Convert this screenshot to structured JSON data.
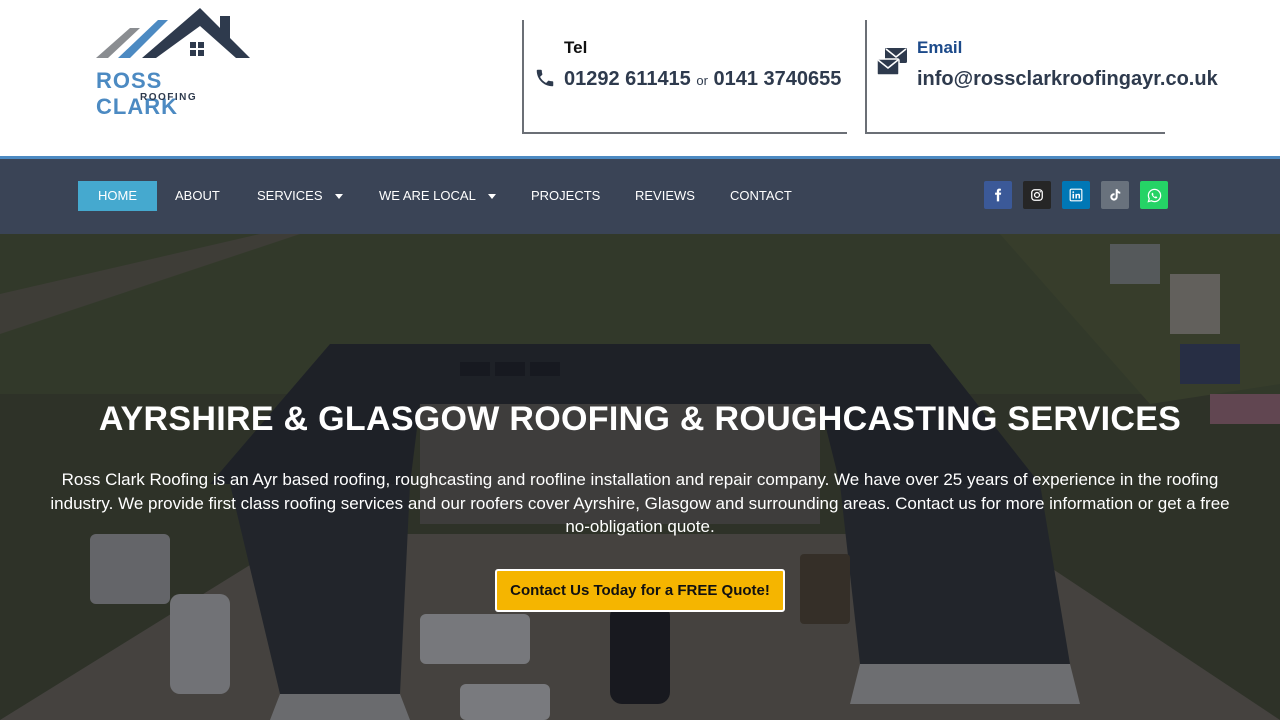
{
  "brand": {
    "name": "ROSS CLARK",
    "subtitle": "ROOFING",
    "colors": {
      "blue": "#4c8ac2",
      "navy": "#2e3a4d",
      "grey": "#8a8d91"
    }
  },
  "contact": {
    "tel": {
      "title": "Tel",
      "icon": "phone-icon",
      "number1": "01292 611415",
      "separator": "or",
      "number2": "0141 3740655"
    },
    "email": {
      "title": "Email",
      "icon": "envelope-icon",
      "address": "info@rossclarkroofingayr.co.uk"
    }
  },
  "nav": {
    "items": [
      {
        "label": "HOME",
        "active": true,
        "dropdown": false
      },
      {
        "label": "ABOUT",
        "active": false,
        "dropdown": false
      },
      {
        "label": "SERVICES",
        "active": false,
        "dropdown": true
      },
      {
        "label": "WE ARE LOCAL",
        "active": false,
        "dropdown": true
      },
      {
        "label": "PROJECTS",
        "active": false,
        "dropdown": false
      },
      {
        "label": "REVIEWS",
        "active": false,
        "dropdown": false
      },
      {
        "label": "CONTACT",
        "active": false,
        "dropdown": false
      }
    ],
    "social": [
      {
        "name": "facebook-icon",
        "color": "#3b5998"
      },
      {
        "name": "instagram-icon",
        "color": "#262626"
      },
      {
        "name": "linkedin-icon",
        "color": "#0077b5"
      },
      {
        "name": "tiktok-icon",
        "color": "#69727d"
      },
      {
        "name": "whatsapp-icon",
        "color": "#25d366"
      }
    ],
    "colors": {
      "bar": "#3a4456",
      "active": "#45a9cf",
      "accent_line": "#4c8ac2"
    }
  },
  "hero": {
    "title": "AYRSHIRE & GLASGOW ROOFING & ROUGHCASTING SERVICES",
    "body": "Ross Clark Roofing is an Ayr based roofing, roughcasting and roofline installation and repair company. We have over 25 years of experience in the roofing industry. We provide first class roofing services and our roofers cover Ayrshire, Glasgow and surrounding areas. Contact us for more information or get a free no-obligation quote.",
    "cta_label": "Contact Us Today for a FREE Quote!",
    "cta_color": "#f5b500"
  }
}
